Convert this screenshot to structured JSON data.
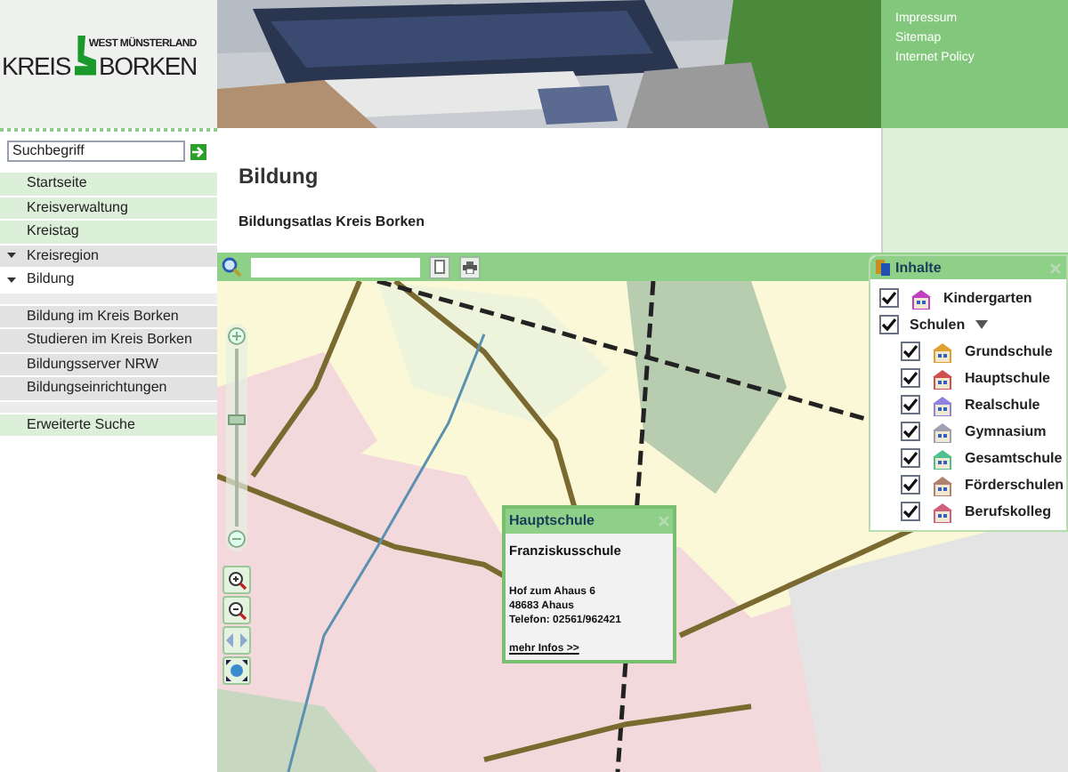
{
  "logo": {
    "top": "WEST MÜNSTERLAND",
    "left": "KREIS",
    "right": "BORKEN"
  },
  "service_links": [
    "Impressum",
    "Sitemap",
    "Internet Policy"
  ],
  "search": {
    "placeholder": "Suchbegriff"
  },
  "nav": [
    {
      "label": "Startseite",
      "kind": "top",
      "selected": false
    },
    {
      "label": "Kreisverwaltung",
      "kind": "top",
      "selected": false
    },
    {
      "label": "Kreistag",
      "kind": "top",
      "selected": false
    },
    {
      "label": "Kreisregion",
      "kind": "expandable",
      "selected": false
    },
    {
      "label": "Bildung",
      "kind": "expandable",
      "selected": true
    },
    {
      "kind": "spacer"
    },
    {
      "label": "Bildung im Kreis Borken",
      "kind": "sub",
      "selected": false
    },
    {
      "label": "Studieren im Kreis Borken",
      "kind": "sub",
      "selected": false
    },
    {
      "label": "Bildungsserver NRW",
      "kind": "sub",
      "selected": false
    },
    {
      "label": "Bildungseinrichtungen",
      "kind": "sub",
      "selected": false
    },
    {
      "kind": "spacer"
    },
    {
      "label": "Erweiterte Suche",
      "kind": "top",
      "selected": false
    }
  ],
  "page": {
    "title": "Bildung",
    "subtitle": "Bildungsatlas Kreis Borken"
  },
  "map": {
    "zoom": {
      "level": 0.6
    },
    "popup": {
      "title": "Hauptschule",
      "name": "Franziskusschule",
      "address": [
        "Hof zum Ahaus 6",
        "48683 Ahaus",
        "Telefon: 02561/962421"
      ],
      "link": "mehr Infos >>"
    },
    "layers": {
      "title": "Inhalte",
      "items": [
        {
          "label": "Kindergarten",
          "checked": true,
          "color": "#c040c0"
        },
        {
          "label": "Schulen",
          "checked": true,
          "expanded": true,
          "children": [
            {
              "label": "Grundschule",
              "checked": true,
              "color": "#e0a030"
            },
            {
              "label": "Hauptschule",
              "checked": true,
              "color": "#d05050"
            },
            {
              "label": "Realschule",
              "checked": true,
              "color": "#9080e0"
            },
            {
              "label": "Gymnasium",
              "checked": true,
              "color": "#a0a0b0"
            },
            {
              "label": "Gesamtschule",
              "checked": true,
              "color": "#50c090"
            },
            {
              "label": "Förderschulen",
              "checked": true,
              "color": "#b08070"
            },
            {
              "label": "Berufskolleg",
              "checked": true,
              "color": "#d06080"
            }
          ]
        }
      ]
    }
  }
}
